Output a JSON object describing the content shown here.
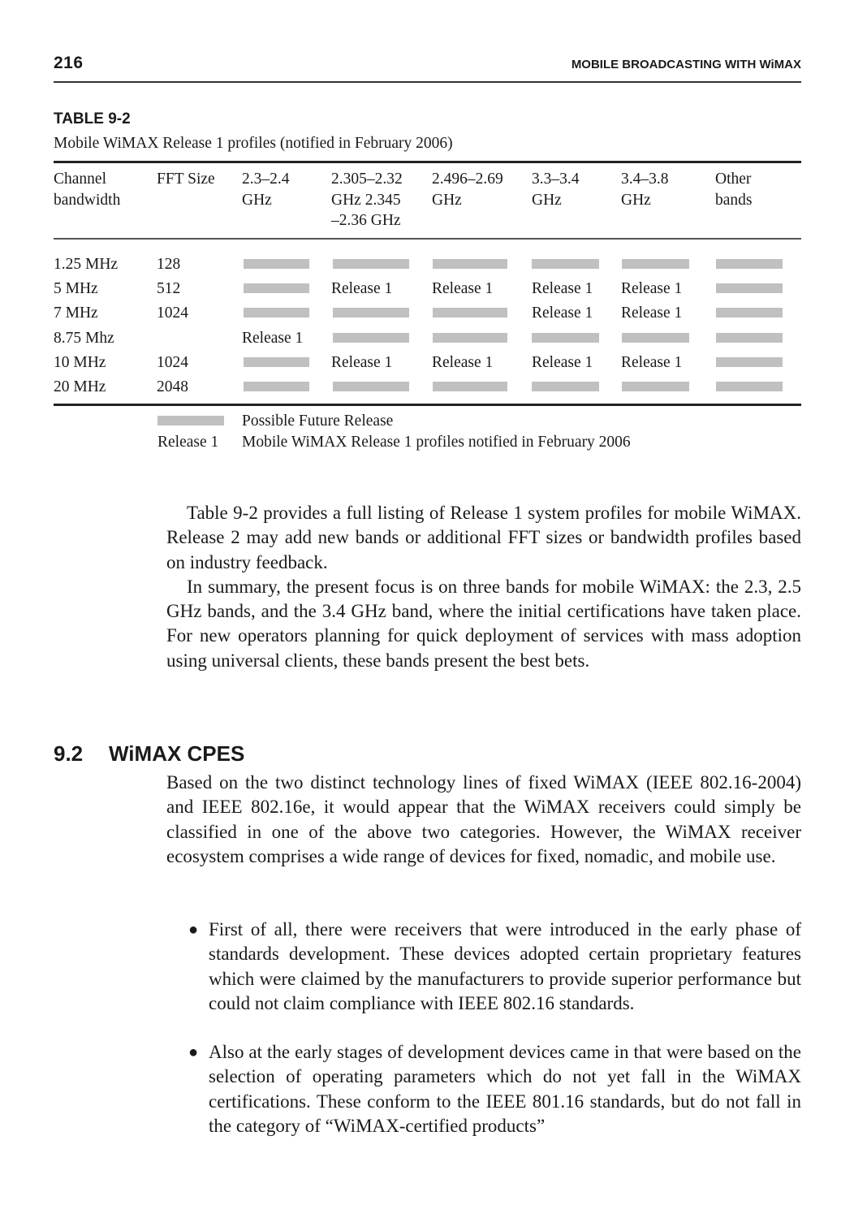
{
  "running_head": {
    "page_number": "216",
    "title": "MOBILE BROADCASTING WITH WiMAX"
  },
  "table": {
    "label": "TABLE 9-2",
    "caption": "Mobile WiMAX Release 1 profiles (notified in February 2006)",
    "headers": [
      [
        "Channel",
        "bandwidth"
      ],
      [
        "FFT Size"
      ],
      [
        "2.3–2.4",
        "GHz"
      ],
      [
        "2.305–2.32",
        "GHz 2.345",
        "–2.36 GHz"
      ],
      [
        "2.496–2.69",
        "GHz"
      ],
      [
        "3.3–3.4",
        "GHz"
      ],
      [
        "3.4–3.8",
        "GHz"
      ],
      [
        "Other",
        "bands"
      ]
    ],
    "rows": [
      {
        "bandwidth": "1.25 MHz",
        "fft": "128",
        "cells": [
          "future",
          "future",
          "future",
          "future",
          "future",
          "future"
        ]
      },
      {
        "bandwidth": "5 MHz",
        "fft": "512",
        "cells": [
          "future",
          "Release 1",
          "Release 1",
          "Release 1",
          "Release 1",
          "future"
        ]
      },
      {
        "bandwidth": "7 MHz",
        "fft": "1024",
        "cells": [
          "future",
          "future",
          "future",
          "Release 1",
          "Release 1",
          "future"
        ]
      },
      {
        "bandwidth": "8.75 Mhz",
        "fft": "",
        "cells": [
          "Release 1",
          "future",
          "future",
          "future",
          "future",
          "future"
        ]
      },
      {
        "bandwidth": "10 MHz",
        "fft": "1024",
        "cells": [
          "future",
          "Release 1",
          "Release 1",
          "Release 1",
          "Release 1",
          "future"
        ]
      },
      {
        "bandwidth": "20 MHz",
        "fft": "2048",
        "cells": [
          "future",
          "future",
          "future",
          "future",
          "future",
          "future"
        ]
      }
    ],
    "legend": {
      "future_label": "Possible Future Release",
      "release_key": "Release 1",
      "release_label": "Mobile WiMAX Release 1 profiles notified in February 2006"
    },
    "future_color": "#c0c0c0"
  },
  "body": {
    "para1": "Table 9-2 provides a full listing of Release 1 system profiles for mobile WiMAX. Release 2 may add new bands or additional FFT sizes or bandwidth profiles based on industry feedback.",
    "para2": "In summary, the present focus is on three bands for mobile WiMAX: the 2.3, 2.5 GHz bands, and the 3.4 GHz band, where the initial certifications have taken place. For new operators planning for quick deployment of services with mass adoption using universal clients, these bands present the best bets."
  },
  "section": {
    "number": "9.2",
    "title": "WiMAX CPES",
    "para": "Based on the two distinct technology lines of fixed WiMAX (IEEE 802.16-2004) and IEEE 802.16e, it would appear that the WiMAX receivers could simply be classified in one of the above two categories. However, the WiMAX receiver ecosystem comprises a wide range of devices for fixed, nomadic, and mobile use.",
    "bullets": [
      "First of all, there were receivers that were introduced in the early phase of standards development. These devices adopted certain proprietary features which were claimed by the manufacturers to provide superior performance but could not claim compliance with IEEE 802.16 standards.",
      "Also at the early stages of development devices came in that were based on the selection of operating parameters which do not yet fall in the WiMAX certifications. These conform to the IEEE 801.16 standards, but do not fall in the category of “WiMAX-certified products”"
    ],
    "bullet_glyph": "●"
  }
}
